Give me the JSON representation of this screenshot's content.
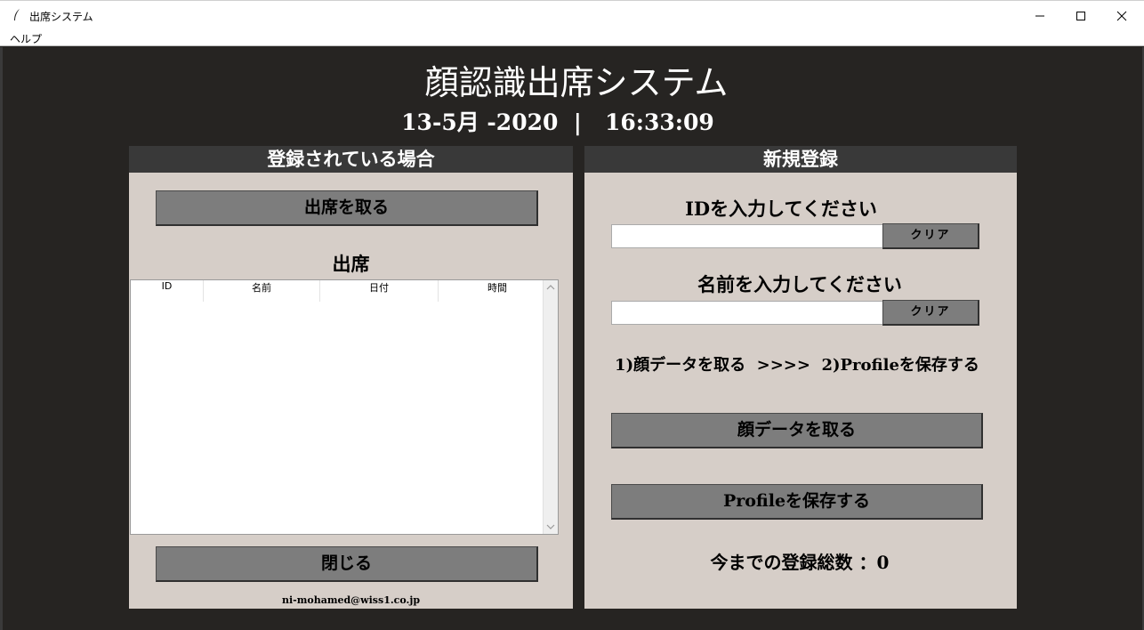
{
  "window": {
    "title": "出席システム",
    "menu_help": "ヘルプ"
  },
  "header": {
    "title": "顔認識出席システム",
    "datetime": "13-5月 -2020  |   16:33:09"
  },
  "left_panel": {
    "header": "登録されている場合",
    "take_attendance_button": "出席を取る",
    "attendance_label": "出席",
    "table": {
      "columns": [
        "ID",
        "名前",
        "日付",
        "時間"
      ],
      "rows": []
    },
    "close_button": "閉じる",
    "email": "ni-mohamed@wiss1.co.jp"
  },
  "right_panel": {
    "header": "新規登録",
    "id_prompt": "IDを入力してください",
    "id_value": "",
    "clear_id_button": "クリア",
    "name_prompt": "名前を入力してください",
    "name_value": "",
    "clear_name_button": "クリア",
    "steps_text": "1)顔データを取る  >>>>  2)Profileを保存する",
    "take_face_data_button": "顔データを取る",
    "save_profile_button": "Profileを保存する",
    "registration_count_text": "今までの登録総数 ：0"
  }
}
